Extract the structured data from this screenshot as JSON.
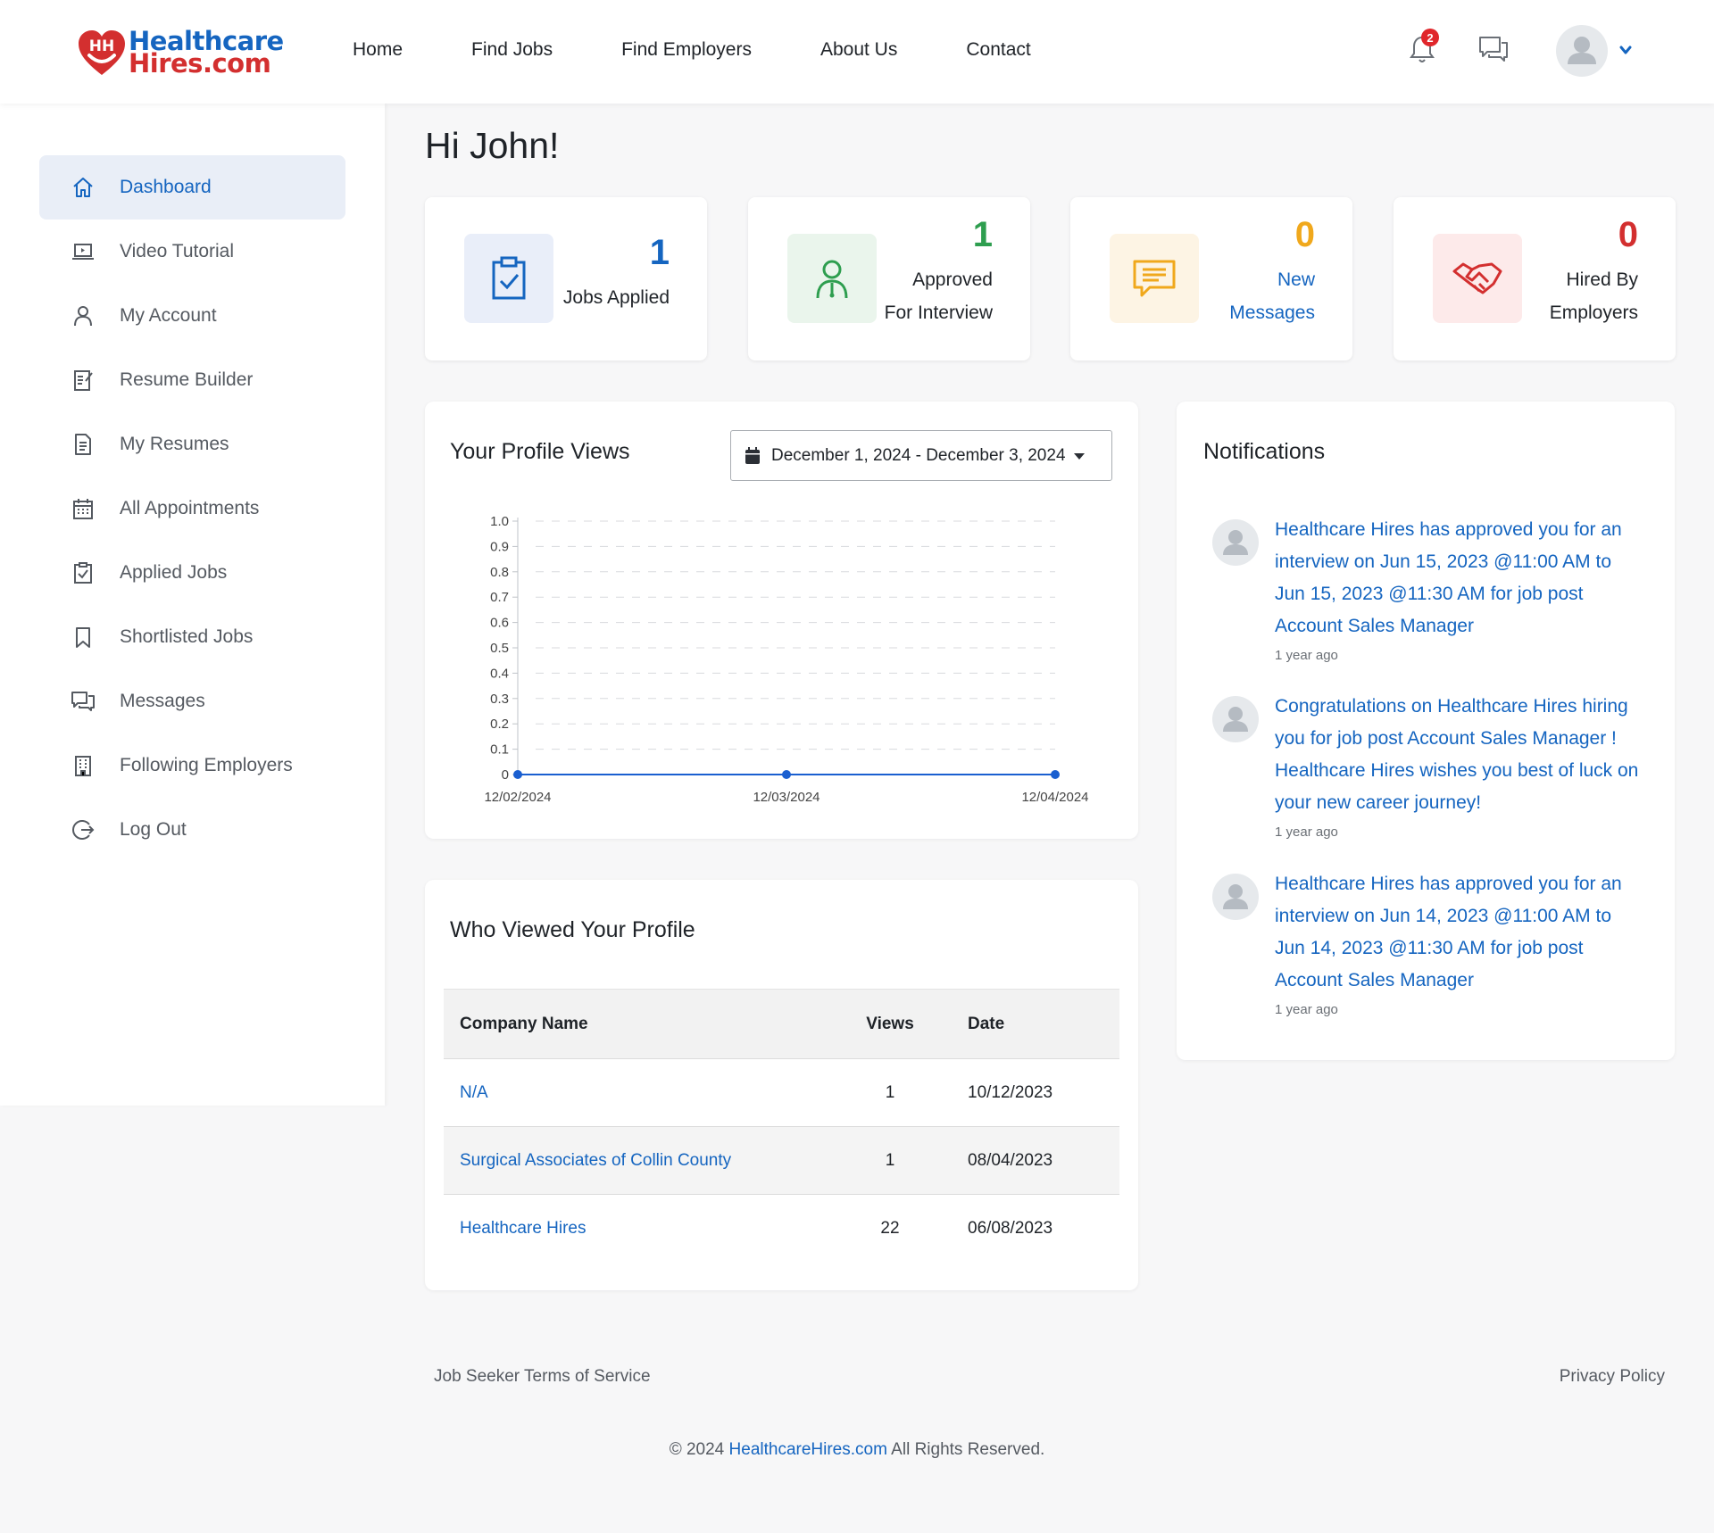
{
  "brand": {
    "line1": "Healthcare",
    "line2": "Hires.com",
    "mark": "HH",
    "primary_color": "#1565c0",
    "accent_color": "#d32f2f"
  },
  "nav": [
    "Home",
    "Find Jobs",
    "Find Employers",
    "About Us",
    "Contact"
  ],
  "header": {
    "notification_count": "2",
    "icons": [
      "bell-icon",
      "chat-icon",
      "user-avatar",
      "chevron-down-icon"
    ]
  },
  "sidebar": {
    "active": "Dashboard",
    "items": [
      {
        "label": "Dashboard",
        "icon": "home-icon"
      },
      {
        "label": "Video Tutorial",
        "icon": "laptop-icon"
      },
      {
        "label": "My Account",
        "icon": "user-icon"
      },
      {
        "label": "Resume Builder",
        "icon": "edit-document-icon"
      },
      {
        "label": "My Resumes",
        "icon": "document-icon"
      },
      {
        "label": "All Appointments",
        "icon": "calendar-icon"
      },
      {
        "label": "Applied Jobs",
        "icon": "clipboard-check-icon"
      },
      {
        "label": "Shortlisted Jobs",
        "icon": "bookmark-icon"
      },
      {
        "label": "Messages",
        "icon": "chat-icon"
      },
      {
        "label": "Following Employers",
        "icon": "building-icon"
      },
      {
        "label": "Log Out",
        "icon": "logout-icon"
      }
    ]
  },
  "greeting": "Hi John!",
  "stats": [
    {
      "value": "1",
      "line1": "Jobs Applied",
      "line2": "",
      "color": "#1565c0",
      "icon": "clipboard-check-icon"
    },
    {
      "value": "1",
      "line1": "Approved",
      "line2": "For Interview",
      "color": "#2e9e4f",
      "icon": "doctor-icon"
    },
    {
      "value": "0",
      "line1": "New",
      "line2": "Messages",
      "color": "#f0a81c",
      "icon": "message-icon"
    },
    {
      "value": "0",
      "line1": "Hired By",
      "line2": "Employers",
      "color": "#d32f2f",
      "icon": "handshake-icon"
    }
  ],
  "profile_views": {
    "title": "Your Profile Views",
    "date_range": "December 1, 2024 - December 3, 2024"
  },
  "chart_data": {
    "type": "line",
    "x": [
      "12/02/2024",
      "12/03/2024",
      "12/04/2024"
    ],
    "series": [
      {
        "values": [
          0,
          0,
          0
        ]
      }
    ],
    "ylim": [
      0,
      1.0
    ],
    "yticks": [
      "0",
      "0.1",
      "0.2",
      "0.3",
      "0.4",
      "0.5",
      "0.6",
      "0.7",
      "0.8",
      "0.9",
      "1.0"
    ],
    "grid": true,
    "color": "#1a5fd0"
  },
  "who_viewed": {
    "title": "Who Viewed Your Profile",
    "columns": [
      "Company Name",
      "Views",
      "Date"
    ],
    "rows": [
      {
        "company": "N/A",
        "views": "1",
        "date": "10/12/2023"
      },
      {
        "company": "Surgical Associates of Collin County",
        "views": "1",
        "date": "08/04/2023"
      },
      {
        "company": "Healthcare Hires",
        "views": "22",
        "date": "06/08/2023"
      }
    ]
  },
  "notifications": {
    "title": "Notifications",
    "items": [
      {
        "text": "Healthcare Hires has approved you for an interview on Jun 15, 2023 @11:00 AM to Jun 15, 2023 @11:30 AM for job post Account Sales Manager",
        "ago": "1 year ago"
      },
      {
        "text": "Congratulations on Healthcare Hires hiring you for job post Account Sales Manager ! Healthcare Hires wishes you best of luck on your new career journey!",
        "ago": "1 year ago"
      },
      {
        "text": "Healthcare Hires has approved you for an interview on Jun 14, 2023 @11:00 AM to Jun 14, 2023 @11:30 AM for job post Account Sales Manager",
        "ago": "1 year ago"
      }
    ]
  },
  "footer": {
    "terms": "Job Seeker Terms of Service",
    "privacy": "Privacy Policy",
    "copy_pre": "© 2024",
    "copy_link": "HealthcareHires.com",
    "copy_post": "All Rights Reserved."
  }
}
